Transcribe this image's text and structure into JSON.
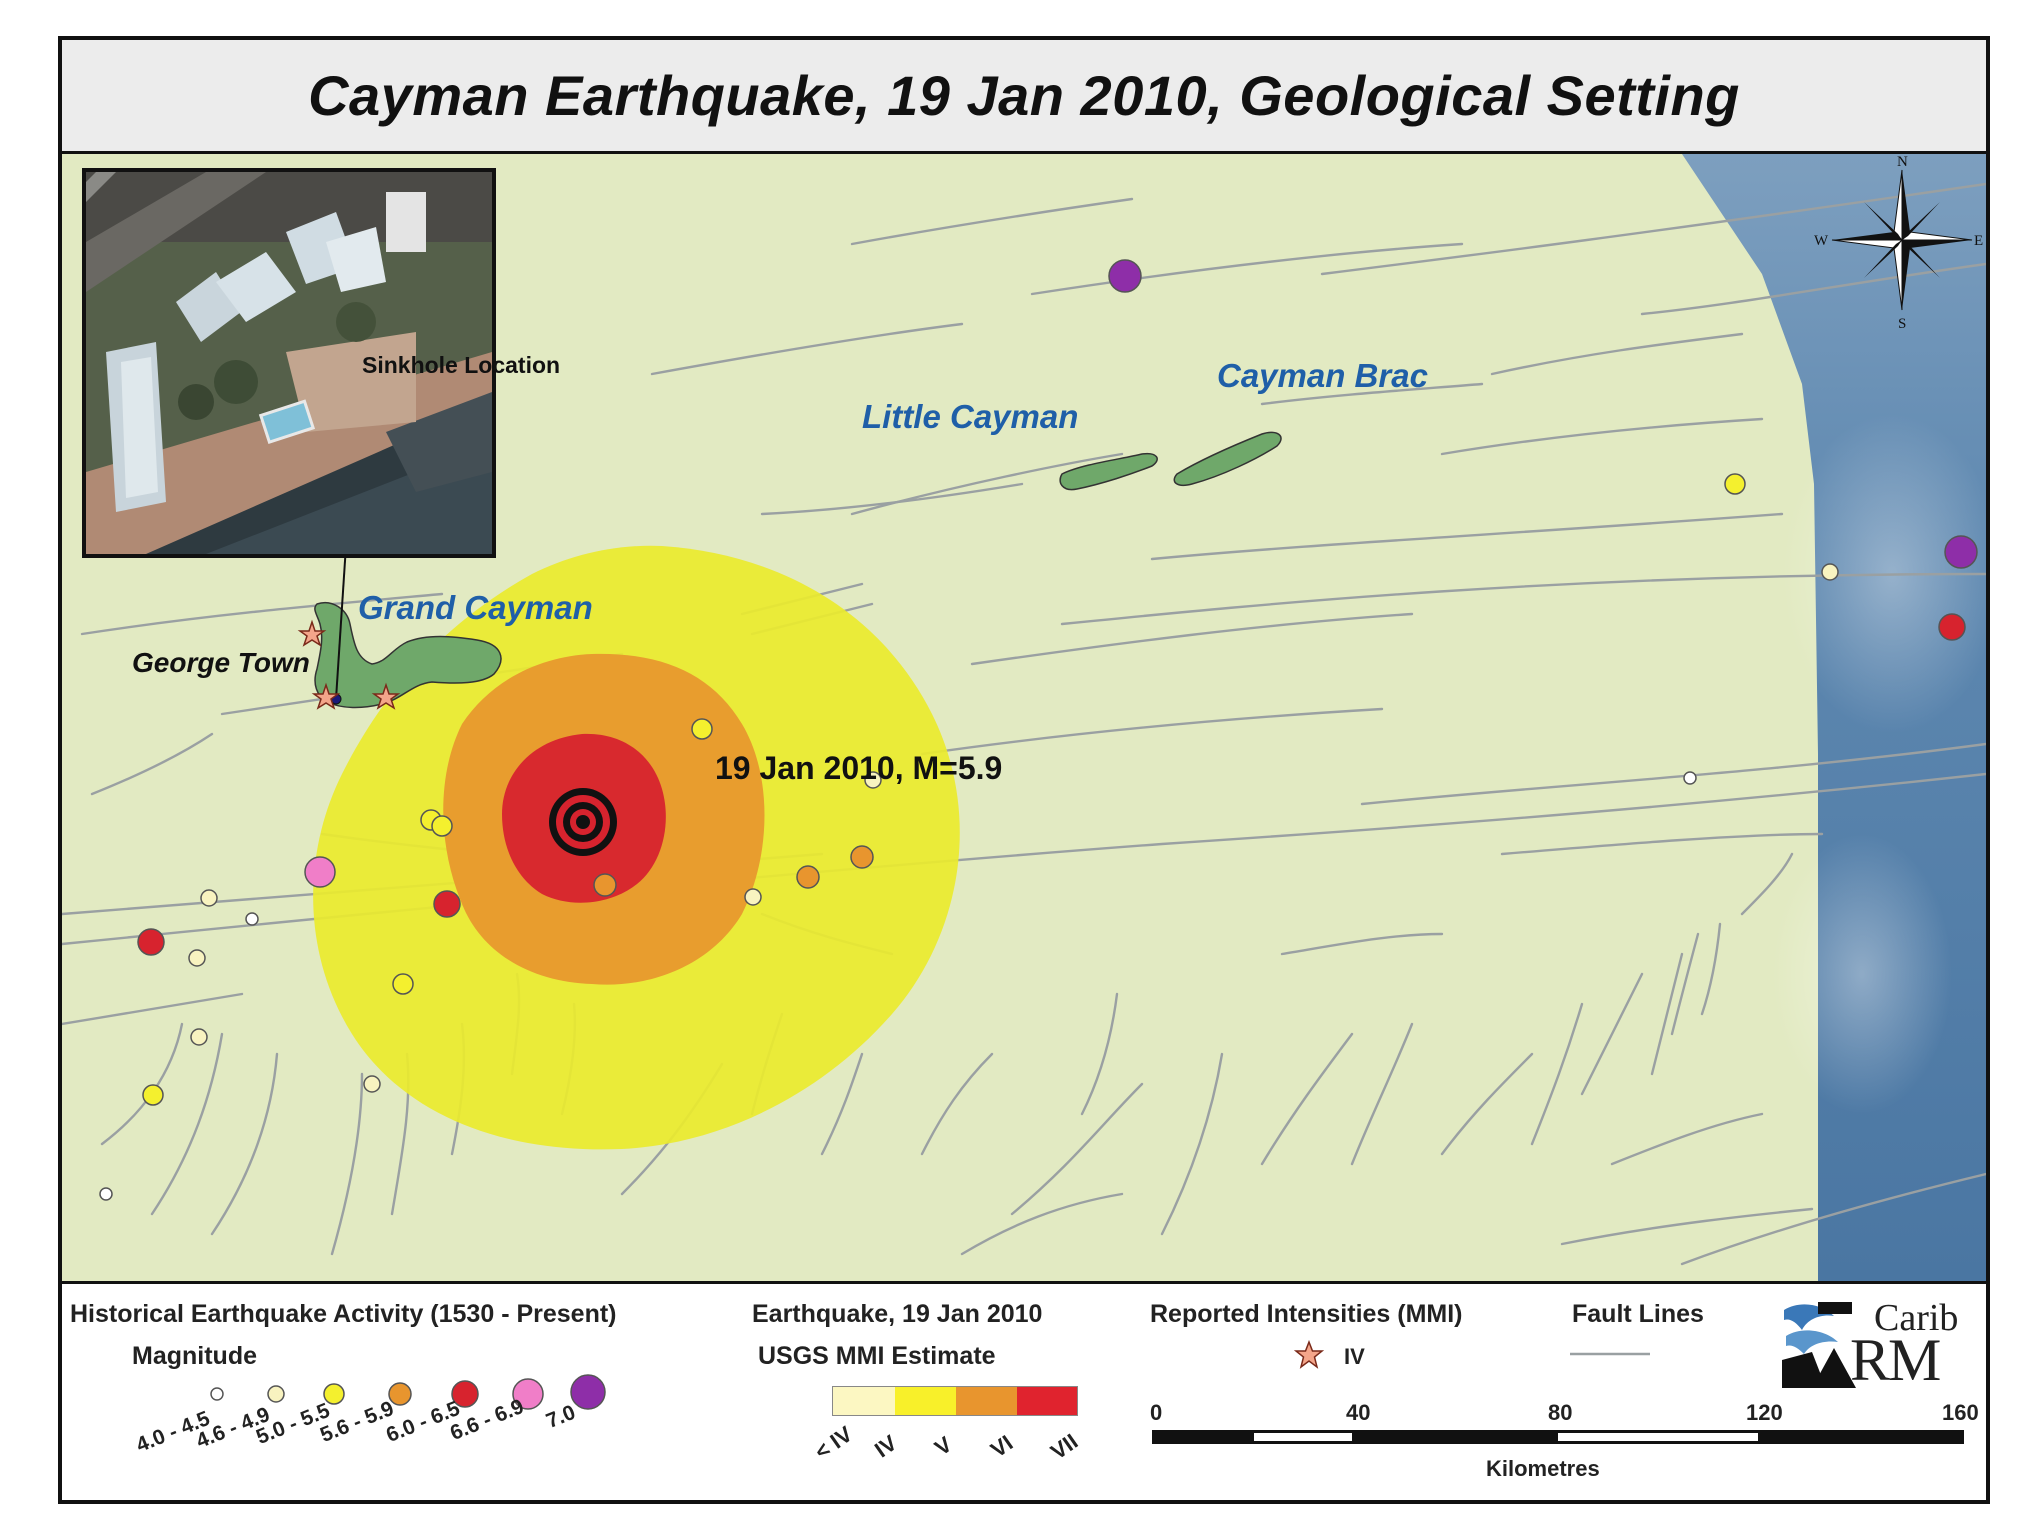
{
  "title": "Cayman Earthquake, 19 Jan 2010, Geological Setting",
  "map": {
    "labels": {
      "grand_cayman": "Grand Cayman",
      "little_cayman": "Little Cayman",
      "cayman_brac": "Cayman Brac",
      "george_town": "George Town",
      "sinkhole": "Sinkhole Location",
      "epicenter": "19 Jan 2010, M=5.9"
    },
    "compass": {
      "n": "N",
      "s": "S",
      "e": "E",
      "w": "W"
    },
    "colors": {
      "land_sea": "#e2eac2",
      "deep_water": "#4f7ca8",
      "island": "#6fa86a",
      "fault": "#9aa0a2",
      "mmi_iv": "#fcf7c2",
      "mmi_v": "#eaea2e",
      "mmi_vi": "#e8952e",
      "mmi_vii": "#d7232e"
    }
  },
  "legend": {
    "historical": {
      "heading": "Historical Earthquake Activity (1530 - Present)",
      "magnitude_label": "Magnitude",
      "ranges": [
        "4.0 - 4.5",
        "4.6 - 4.9",
        "5.0 - 5.5",
        "5.6 - 5.9",
        "6.0 - 6.5",
        "6.6 - 6.9",
        "7.0"
      ]
    },
    "event": {
      "heading": "Earthquake, 19 Jan 2010",
      "sub": "USGS MMI Estimate",
      "ticks": [
        "< IV",
        "IV",
        "V",
        "VI",
        "VII"
      ]
    },
    "intensities": {
      "heading": "Reported Intensities (MMI)",
      "value": "IV"
    },
    "faults": {
      "heading": "Fault Lines"
    },
    "scale": {
      "ticks": [
        "0",
        "40",
        "80",
        "120",
        "160"
      ],
      "unit": "Kilometres"
    },
    "logo": {
      "carib": "Carib",
      "rm": "RM"
    }
  }
}
